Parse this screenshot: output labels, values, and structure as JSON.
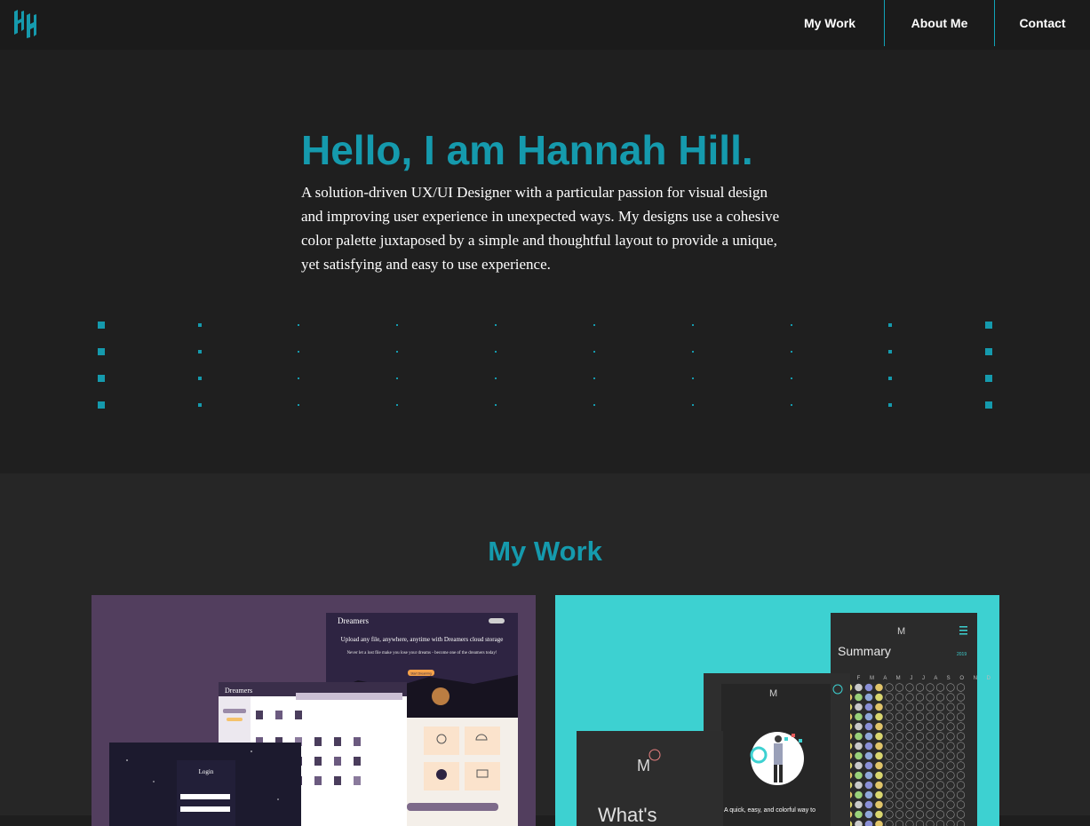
{
  "header": {
    "logo_icon": "hh-monogram-icon",
    "nav": [
      {
        "label": "My Work"
      },
      {
        "label": "About Me"
      },
      {
        "label": "Contact"
      }
    ]
  },
  "hero": {
    "title": "Hello, I am Hannah Hill.",
    "description": "A solution-driven UX/UI Designer with a particular passion for visual design and improving user experience in unexpected ways. My designs use a cohesive color palette juxtaposed by a simple and thoughtful layout to provide a unique, yet satisfying and easy to use experience."
  },
  "work": {
    "title": "My Work",
    "projects": [
      {
        "brand": "Dreamers",
        "headline": "Upload any file, anywhere, anytime with Dreamers cloud storage",
        "subline": "Never let a lost file make you lose your dreams - become one of the dreamers today!",
        "cta": "Start Dreaming",
        "login_label": "Login"
      },
      {
        "summary_label": "Summary",
        "months": "J F M A M J J A S O N D",
        "tagline": "A quick, easy, and colorful way to",
        "whats_label": "What's"
      }
    ]
  },
  "colors": {
    "accent": "#159aad",
    "header_bg": "#1b1b1b",
    "hero_bg": "#1f1f1f",
    "section_bg": "#262626",
    "dreamers_bg": "#523e5e",
    "mood_bg": "#3dd1d1"
  }
}
